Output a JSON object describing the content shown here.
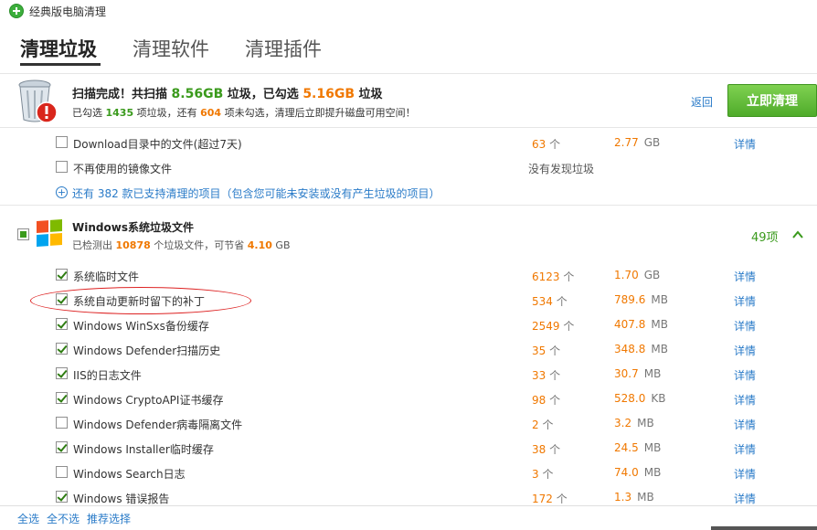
{
  "window": {
    "title": "经典版电脑清理"
  },
  "tabs": [
    {
      "label": "清理垃圾"
    },
    {
      "label": "清理软件"
    },
    {
      "label": "清理插件"
    }
  ],
  "summary": {
    "line1": {
      "prefix": "扫描完成！共扫描 ",
      "scanned": "8.56GB",
      "mid1": " 垃圾，已勾选 ",
      "selected": "5.16GB",
      "suffix": " 垃圾"
    },
    "line2": {
      "prefix": "已勾选 ",
      "checked_count": "1435",
      "mid1": " 项垃圾，还有 ",
      "unchecked_count": "604",
      "suffix": " 项未勾选，清理后立即提升磁盘可用空间！"
    },
    "back_label": "返回",
    "clean_label": "立即清理"
  },
  "top_rows": [
    {
      "label": "Download目录中的文件(超过7天)",
      "count": "63",
      "count_unit": "个",
      "size": "2.77",
      "size_unit": "GB",
      "detail": "详情",
      "checked": false
    },
    {
      "label": "不再使用的镜像文件",
      "none_text": "没有发现垃圾",
      "checked": false
    }
  ],
  "more_link": "还有 382 款已支持清理的项目（包含您可能未安装或没有产生垃圾的项目）",
  "group": {
    "title": "Windows系统垃圾文件",
    "sub_prefix": "已检测出 ",
    "sub_files": "10878",
    "sub_mid": " 个垃圾文件，可节省 ",
    "sub_size": "4.10",
    "sub_unit": " GB",
    "count_label": "49项",
    "logo_colors": [
      "#f25022",
      "#7fba00",
      "#00a4ef",
      "#ffb900"
    ]
  },
  "rows": [
    {
      "label": "系统临时文件",
      "count": "6123",
      "count_unit": "个",
      "size": "1.70",
      "size_unit": "GB",
      "detail": "详情",
      "checked": true
    },
    {
      "label": "系统自动更新时留下的补丁",
      "count": "534",
      "count_unit": "个",
      "size": "789.6",
      "size_unit": "MB",
      "detail": "详情",
      "checked": true
    },
    {
      "label": "Windows WinSxs备份缓存",
      "count": "2549",
      "count_unit": "个",
      "size": "407.8",
      "size_unit": "MB",
      "detail": "详情",
      "checked": true
    },
    {
      "label": "Windows Defender扫描历史",
      "count": "35",
      "count_unit": "个",
      "size": "348.8",
      "size_unit": "MB",
      "detail": "详情",
      "checked": true
    },
    {
      "label": "IIS的日志文件",
      "count": "33",
      "count_unit": "个",
      "size": "30.7",
      "size_unit": "MB",
      "detail": "详情",
      "checked": true
    },
    {
      "label": "Windows CryptoAPI证书缓存",
      "count": "98",
      "count_unit": "个",
      "size": "528.0",
      "size_unit": "KB",
      "detail": "详情",
      "checked": true
    },
    {
      "label": "Windows Defender病毒隔离文件",
      "count": "2",
      "count_unit": "个",
      "size": "3.2",
      "size_unit": "MB",
      "detail": "详情",
      "checked": false
    },
    {
      "label": "Windows Installer临时缓存",
      "count": "38",
      "count_unit": "个",
      "size": "24.5",
      "size_unit": "MB",
      "detail": "详情",
      "checked": true
    },
    {
      "label": "Windows Search日志",
      "count": "3",
      "count_unit": "个",
      "size": "74.0",
      "size_unit": "MB",
      "detail": "详情",
      "checked": false
    },
    {
      "label": "Windows 错误报告",
      "count": "172",
      "count_unit": "个",
      "size": "1.3",
      "size_unit": "MB",
      "detail": "详情",
      "checked": true
    }
  ],
  "footer": {
    "select_all": "全选",
    "select_none": "全不选",
    "recommend": "推荐选择"
  }
}
